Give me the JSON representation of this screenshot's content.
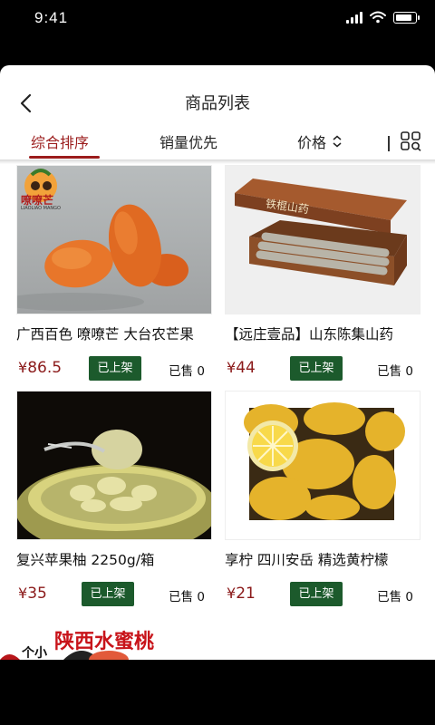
{
  "status": {
    "time": "9:41"
  },
  "nav": {
    "title": "商品列表"
  },
  "sort": {
    "comprehensive": "综合排序",
    "sales": "销量优先",
    "price": "价格"
  },
  "products": [
    {
      "name": "广西百色 嘹嘹芒 大台农芒果",
      "price_symbol": "¥",
      "price": "86.5",
      "badge": "已上架",
      "sold": "已售 0",
      "logo_text": "嘹嘹芒",
      "logo_sub": "LIAOLIAO MANGO"
    },
    {
      "name": "【远庄壹品】山东陈集山药",
      "price_symbol": "¥",
      "price": "44",
      "badge": "已上架",
      "sold": "已售 0",
      "box_text": "铁棍山药"
    },
    {
      "name": "复兴苹果柚 2250g/箱",
      "price_symbol": "¥",
      "price": "35",
      "badge": "已上架",
      "sold": "已售 0"
    },
    {
      "name": "享柠 四川安岳 精选黄柠檬",
      "price_symbol": "¥",
      "price": "21",
      "badge": "已上架",
      "sold": "已售 0"
    }
  ],
  "promo": {
    "text": "陕西水蜜桃",
    "small": "个小"
  },
  "colors": {
    "accent": "#9b1c1c",
    "badge": "#1c5a2c",
    "price": "#8b1a1a"
  }
}
